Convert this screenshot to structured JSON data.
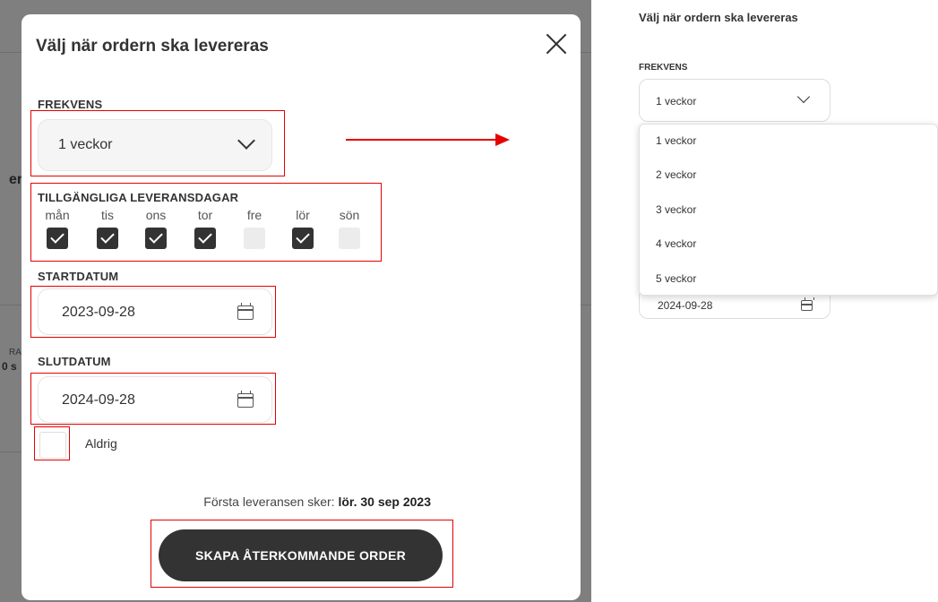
{
  "modal": {
    "title": "Välj när ordern ska levereras",
    "frequency_label": "FREKVENS",
    "frequency_value": "1 veckor",
    "days_label": "TILLGÄNGLIGA LEVERANSDAGAR",
    "days": [
      {
        "name": "mån",
        "checked": true
      },
      {
        "name": "tis",
        "checked": true
      },
      {
        "name": "ons",
        "checked": true
      },
      {
        "name": "tor",
        "checked": true
      },
      {
        "name": "fre",
        "checked": false
      },
      {
        "name": "lör",
        "checked": true
      },
      {
        "name": "sön",
        "checked": false
      }
    ],
    "start_label": "STARTDATUM",
    "start_value": "2023-09-28",
    "end_label": "SLUTDATUM",
    "end_value": "2024-09-28",
    "never_label": "Aldrig",
    "first_delivery_prefix": "Första leveransen sker:",
    "first_delivery_date": "lör. 30 sep 2023",
    "create_button": "SKAPA ÅTERKOMMANDE ORDER"
  },
  "background_fragments": [
    "er",
    "RA",
    "0 s"
  ],
  "dropdown_panel": {
    "title": "Välj när ordern ska levereras",
    "frequency_label": "FREKVENS",
    "frequency_value": "1 veckor",
    "options": [
      "1 veckor",
      "2 veckor",
      "3 veckor",
      "4 veckor",
      "5 veckor"
    ],
    "end_value": "2024-09-28"
  },
  "colors": {
    "highlight": "#e60000",
    "button": "#333333",
    "backdrop": "#7f7f7f"
  }
}
